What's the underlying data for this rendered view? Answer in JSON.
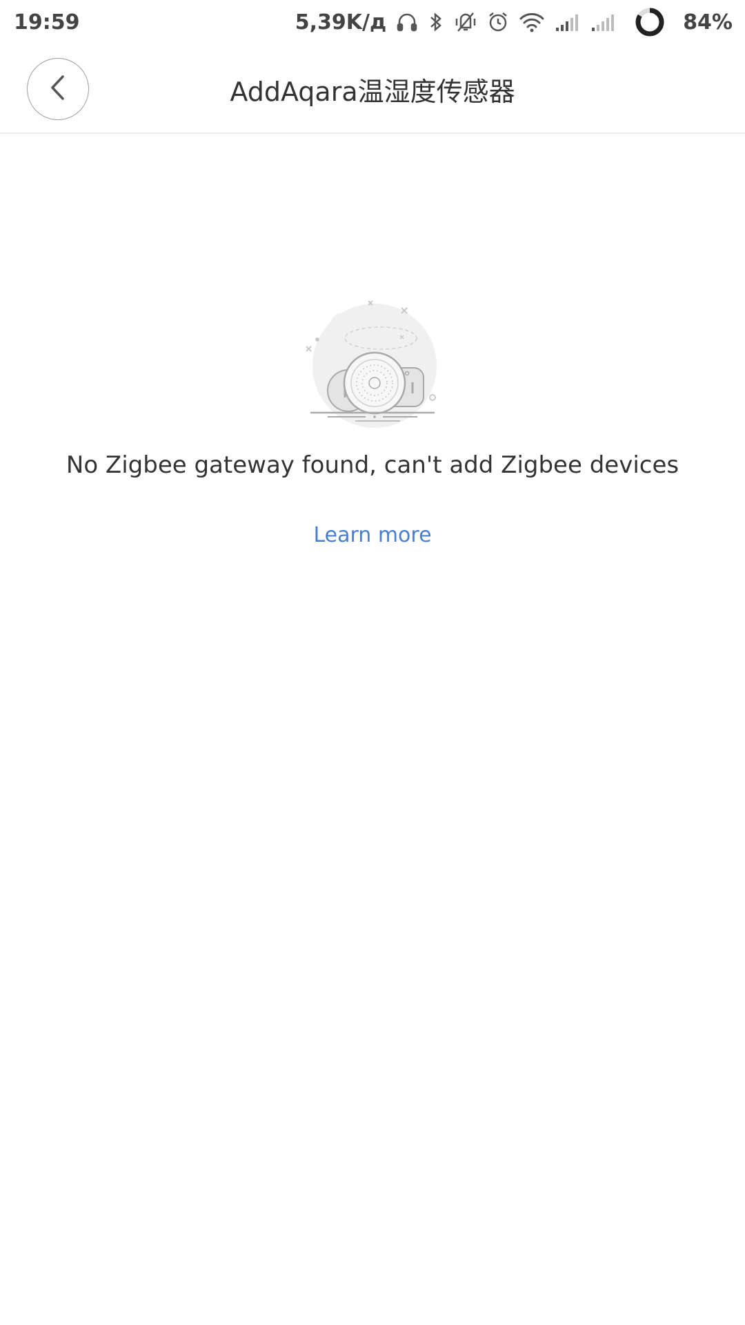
{
  "status_bar": {
    "time": "19:59",
    "network_speed": "5,39K/д",
    "battery": "84%",
    "battery_level": 84,
    "icons": [
      "headphones-icon",
      "bluetooth-icon",
      "vibrate-off-icon",
      "alarm-icon",
      "wifi-icon",
      "signal-icon",
      "signal-icon-2",
      "battery-ring-icon"
    ]
  },
  "header": {
    "title": "AddAqara温湿度传感器",
    "back_icon": "chevron-left-icon"
  },
  "empty_state": {
    "message": "No Zigbee gateway found, can't add Zigbee devices",
    "link_label": "Learn more",
    "illustration": "zigbee-devices-illustration"
  },
  "colors": {
    "link": "#4a7fcf",
    "text": "#333333",
    "divider": "#ececec"
  }
}
